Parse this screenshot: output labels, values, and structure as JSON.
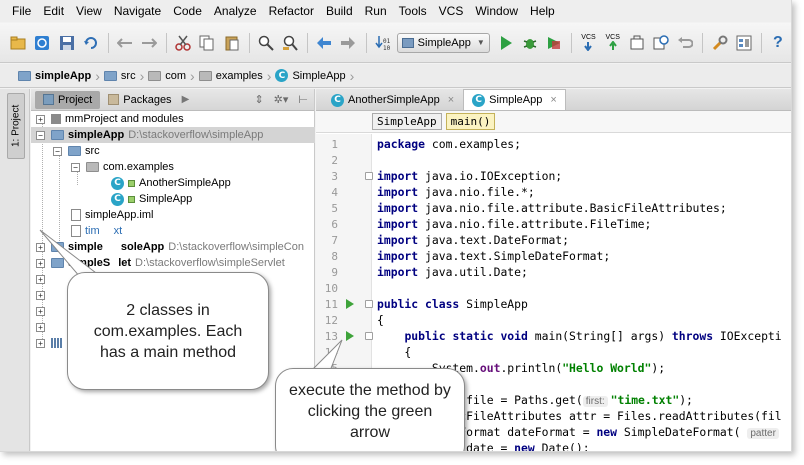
{
  "menu": [
    "File",
    "Edit",
    "View",
    "Navigate",
    "Code",
    "Analyze",
    "Refactor",
    "Build",
    "Run",
    "Tools",
    "VCS",
    "Window",
    "Help"
  ],
  "toolbar": {
    "run_config": "SimpleApp",
    "vcs_label_1": "VCS",
    "vcs_label_2": "VCS",
    "help_glyph": "?",
    "icons": [
      "open-folder-icon",
      "sync-icon",
      "save-icon",
      "refresh-icon",
      "undo-icon",
      "redo-icon",
      "cut-icon",
      "copy-icon",
      "paste-icon",
      "find-icon",
      "find-replace-icon",
      "back-icon",
      "forward-icon",
      "make-icon",
      "run-icon",
      "debug-icon",
      "coverage-icon",
      "vcs-update-icon",
      "vcs-commit-icon",
      "history-icon",
      "annotate-icon",
      "revert-icon",
      "settings-icon",
      "structure-icon",
      "help-icon"
    ]
  },
  "breadcrumb": [
    "simpleApp",
    "src",
    "com",
    "examples",
    "SimpleApp"
  ],
  "left_strip": {
    "tab": "1: Project"
  },
  "project_panel": {
    "tabs": [
      "Project",
      "Packages"
    ],
    "tree": {
      "mm_project": "mmProject and modules",
      "simpleapp": "simpleApp",
      "simpleapp_path": "D:\\stackoverflow\\simpleApp",
      "src": "src",
      "package": "com.examples",
      "class1": "AnotherSimpleApp",
      "class2": "SimpleApp",
      "iml_prefix": "sim",
      "iml_suffix": "pleApp.iml",
      "time_prefix": "tim",
      "time_suffix": "xt",
      "console_prefix": "simple",
      "console_suffix": "sole",
      "console_mid": "App",
      "console_path": "D:\\stackoverflow\\simpleCon",
      "servlet_prefix": "simpleS",
      "servlet_suffix": "let",
      "servlet_path": "D:\\stackoverflow\\simpleServlet"
    }
  },
  "editor": {
    "tabs": [
      "AnotherSimpleApp",
      "SimpleApp"
    ],
    "crumbs": [
      "SimpleApp",
      "main()"
    ],
    "lines": [
      {
        "n": "1",
        "segments": [
          {
            "t": "package",
            "c": "kw"
          },
          {
            "t": " com.examples;",
            "c": ""
          }
        ]
      },
      {
        "n": "2",
        "segments": []
      },
      {
        "n": "3",
        "segments": [
          {
            "t": "import",
            "c": "kw"
          },
          {
            "t": " java.io.IOException;",
            "c": ""
          }
        ]
      },
      {
        "n": "4",
        "segments": [
          {
            "t": "import",
            "c": "kw"
          },
          {
            "t": " java.nio.file.*;",
            "c": ""
          }
        ]
      },
      {
        "n": "5",
        "segments": [
          {
            "t": "import",
            "c": "kw"
          },
          {
            "t": " java.nio.file.attribute.BasicFileAttributes;",
            "c": ""
          }
        ]
      },
      {
        "n": "6",
        "segments": [
          {
            "t": "import",
            "c": "kw"
          },
          {
            "t": " java.nio.file.attribute.FileTime;",
            "c": ""
          }
        ]
      },
      {
        "n": "7",
        "segments": [
          {
            "t": "import",
            "c": "kw"
          },
          {
            "t": " java.text.DateFormat;",
            "c": ""
          }
        ]
      },
      {
        "n": "8",
        "segments": [
          {
            "t": "import",
            "c": "kw"
          },
          {
            "t": " java.text.SimpleDateFormat;",
            "c": ""
          }
        ]
      },
      {
        "n": "9",
        "segments": [
          {
            "t": "import",
            "c": "kw"
          },
          {
            "t": " java.util.Date;",
            "c": ""
          }
        ]
      },
      {
        "n": "10",
        "segments": []
      },
      {
        "n": "11",
        "segments": [
          {
            "t": "public class",
            "c": "kw"
          },
          {
            "t": " SimpleApp",
            "c": ""
          }
        ]
      },
      {
        "n": "12",
        "segments": [
          {
            "t": "{",
            "c": ""
          }
        ]
      },
      {
        "n": "13",
        "segments": [
          {
            "t": "    ",
            "c": ""
          },
          {
            "t": "public static void",
            "c": "kw"
          },
          {
            "t": " main(String[] args) ",
            "c": ""
          },
          {
            "t": "throws",
            "c": "kw"
          },
          {
            "t": " IOExcepti",
            "c": ""
          }
        ]
      },
      {
        "n": "14",
        "segments": [
          {
            "t": "    {",
            "c": ""
          }
        ]
      },
      {
        "n": "15",
        "segments": [
          {
            "t": "        System.",
            "c": ""
          },
          {
            "t": "out",
            "c": "fld"
          },
          {
            "t": ".println(",
            "c": ""
          },
          {
            "t": "\"Hello World\"",
            "c": "str"
          },
          {
            "t": ");",
            "c": ""
          }
        ]
      },
      {
        "n": "16",
        "segments": []
      },
      {
        "n": "17",
        "segments": [
          {
            "t": "        Path file = Paths.get(",
            "c": ""
          },
          {
            "t": "first:",
            "c": "hint"
          },
          {
            "t": "\"time.txt\"",
            "c": "str"
          },
          {
            "t": ");",
            "c": ""
          }
        ]
      },
      {
        "n": "18",
        "segments": [
          {
            "t": "        BasicFileAttributes attr = Files.readAttributes(fil",
            "c": ""
          }
        ]
      },
      {
        "n": "19",
        "segments": [
          {
            "t": "        DateFormat dateFormat = ",
            "c": ""
          },
          {
            "t": "new",
            "c": "kw"
          },
          {
            "t": " SimpleDateFormat( ",
            "c": ""
          },
          {
            "t": "patter",
            "c": "hint"
          }
        ]
      },
      {
        "n": "20",
        "segments": [
          {
            "t": "        Date date = ",
            "c": ""
          },
          {
            "t": "new",
            "c": "kw"
          },
          {
            "t": " Date();",
            "c": ""
          }
        ]
      }
    ]
  },
  "callouts": {
    "classes": "2 classes in com.examples. Each has a main method",
    "execute": "execute the method by clicking the green arrow"
  },
  "colors": {
    "keyword": "#000080",
    "string": "#008000",
    "field": "#660e7a",
    "run_arrow": "#3ea33a",
    "class_icon": "#2aa4c7",
    "selected_row": "#d4d4d4"
  }
}
